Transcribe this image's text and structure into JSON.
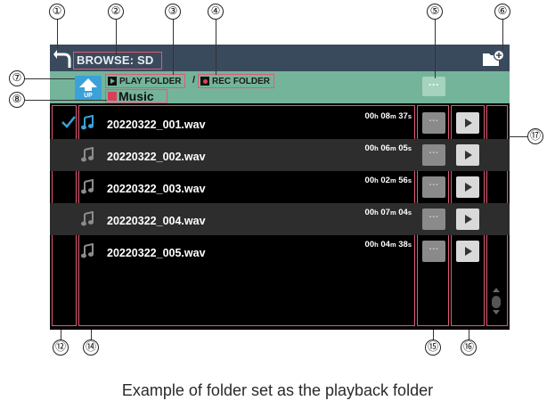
{
  "header": {
    "title": "BROWSE: SD"
  },
  "folders": {
    "up_label": "UP",
    "play_folder_label": "PLAY FOLDER",
    "rec_folder_label": "REC FOLDER",
    "current_folder": "Music",
    "more_label": "···"
  },
  "files": [
    {
      "name": "20220322_001.wav",
      "dur_h": "00",
      "dur_m": "08",
      "dur_s": "37",
      "selected": true
    },
    {
      "name": "20220322_002.wav",
      "dur_h": "00",
      "dur_m": "06",
      "dur_s": "05",
      "selected": false
    },
    {
      "name": "20220322_003.wav",
      "dur_h": "00",
      "dur_m": "02",
      "dur_s": "56",
      "selected": false
    },
    {
      "name": "20220322_004.wav",
      "dur_h": "00",
      "dur_m": "07",
      "dur_s": "04",
      "selected": false
    },
    {
      "name": "20220322_005.wav",
      "dur_h": "00",
      "dur_m": "04",
      "dur_s": "38",
      "selected": false
    }
  ],
  "units": {
    "h": "h",
    "m": "m",
    "s": "s"
  },
  "callouts": [
    "①",
    "②",
    "③",
    "④",
    "⑤",
    "⑥",
    "⑦",
    "⑧",
    "⑫",
    "⑭",
    "⑮",
    "⑯",
    "⑰"
  ],
  "caption": "Example of folder set as the playback folder",
  "icons": [
    "back-icon",
    "new-folder-icon",
    "up-folder-icon",
    "play-folder-icon",
    "rec-folder-icon",
    "folder-icon",
    "check-icon",
    "music-note-icon",
    "play-icon",
    "scroll-indicator-icon"
  ],
  "colors": {
    "topbar": "#3a4a5d",
    "subbar": "#74b49a",
    "highlight": "#e05a75",
    "up_button": "#3aa2d8",
    "selected_note": "#3aa2d8"
  }
}
